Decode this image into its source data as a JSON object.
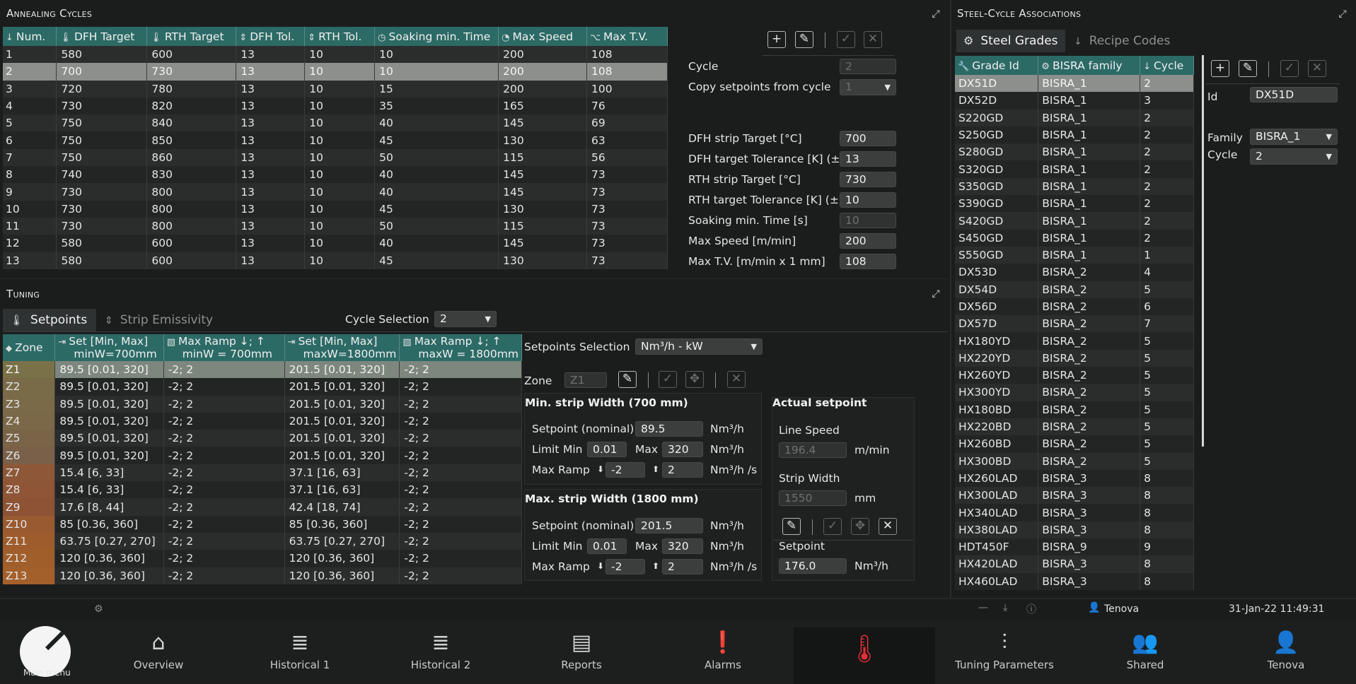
{
  "annealing": {
    "title": "Annealing Cycles",
    "columns": [
      "Num.",
      "DFH Target",
      "RTH Target",
      "DFH Tol.",
      "RTH Tol.",
      "Soaking min. Time",
      "Max Speed",
      "Max T.V."
    ],
    "column_icons": [
      "sort-numeric-icon",
      "thermometer-icon",
      "thermometer-icon",
      "arrows-vertical-icon",
      "arrows-vertical-icon",
      "clock-icon",
      "speedometer-icon",
      "tv-icon"
    ],
    "rows": [
      [
        "1",
        "580",
        "600",
        "13",
        "10",
        "10",
        "200",
        "108"
      ],
      [
        "2",
        "700",
        "730",
        "13",
        "10",
        "10",
        "200",
        "108"
      ],
      [
        "3",
        "720",
        "780",
        "13",
        "10",
        "15",
        "200",
        "100"
      ],
      [
        "4",
        "730",
        "820",
        "13",
        "10",
        "35",
        "165",
        "76"
      ],
      [
        "5",
        "750",
        "840",
        "13",
        "10",
        "40",
        "145",
        "69"
      ],
      [
        "6",
        "750",
        "850",
        "13",
        "10",
        "45",
        "130",
        "63"
      ],
      [
        "7",
        "750",
        "860",
        "13",
        "10",
        "50",
        "115",
        "56"
      ],
      [
        "8",
        "740",
        "830",
        "13",
        "10",
        "40",
        "145",
        "73"
      ],
      [
        "9",
        "730",
        "800",
        "13",
        "10",
        "40",
        "145",
        "73"
      ],
      [
        "10",
        "730",
        "800",
        "13",
        "10",
        "45",
        "130",
        "73"
      ],
      [
        "11",
        "730",
        "800",
        "13",
        "10",
        "50",
        "115",
        "73"
      ],
      [
        "12",
        "580",
        "600",
        "13",
        "10",
        "40",
        "145",
        "73"
      ],
      [
        "13",
        "580",
        "600",
        "13",
        "10",
        "45",
        "130",
        "73"
      ]
    ],
    "selected_row": 1,
    "form": {
      "cycle_label": "Cycle",
      "cycle_value": "2",
      "copy_label": "Copy setpoints from cycle",
      "copy_value": "1",
      "dfh_target_label": "DFH strip Target [°C]",
      "dfh_target_value": "700",
      "dfh_tol_label": "DFH target Tolerance [K] (±)",
      "dfh_tol_value": "13",
      "rth_target_label": "RTH strip Target [°C]",
      "rth_target_value": "730",
      "rth_tol_label": "RTH target Tolerance [K] (±)",
      "rth_tol_value": "10",
      "soak_label": "Soaking min. Time [s]",
      "soak_value": "10",
      "maxspeed_label": "Max Speed [m/min]",
      "maxspeed_value": "200",
      "maxtv_label": "Max T.V. [m/min x 1 mm]",
      "maxtv_value": "108"
    }
  },
  "tuning": {
    "title": "Tuning",
    "tabs": [
      "Setpoints",
      "Strip Emissivity"
    ],
    "cycle_selection_label": "Cycle Selection",
    "cycle_selection_value": "2",
    "columns": [
      "Zone",
      "Set [Min, Max] minW=700mm",
      "Max Ramp ↓; ↑ minW = 700mm",
      "Set [Min, Max] maxW=1800mm",
      "Max Ramp ↓; ↑ maxW = 1800mm"
    ],
    "col_a": [
      "Set [Min, Max]",
      "minW=700mm"
    ],
    "col_b": [
      "Max Ramp ↓; ↑",
      "minW = 700mm"
    ],
    "col_c": [
      "Set [Min, Max]",
      "maxW=1800mm"
    ],
    "col_d": [
      "Max Ramp ↓; ↑",
      "maxW = 1800mm"
    ],
    "rows": [
      [
        "Z1",
        "89.5 [0.01, 320]",
        "-2; 2",
        "201.5 [0.01, 320]",
        "-2; 2"
      ],
      [
        "Z2",
        "89.5 [0.01, 320]",
        "-2; 2",
        "201.5 [0.01, 320]",
        "-2; 2"
      ],
      [
        "Z3",
        "89.5 [0.01, 320]",
        "-2; 2",
        "201.5 [0.01, 320]",
        "-2; 2"
      ],
      [
        "Z4",
        "89.5 [0.01, 320]",
        "-2; 2",
        "201.5 [0.01, 320]",
        "-2; 2"
      ],
      [
        "Z5",
        "89.5 [0.01, 320]",
        "-2; 2",
        "201.5 [0.01, 320]",
        "-2; 2"
      ],
      [
        "Z6",
        "89.5 [0.01, 320]",
        "-2; 2",
        "201.5 [0.01, 320]",
        "-2; 2"
      ],
      [
        "Z7",
        "15.4 [6, 33]",
        "-2; 2",
        "37.1 [16, 63]",
        "-2; 2"
      ],
      [
        "Z8",
        "15.4 [6, 33]",
        "-2; 2",
        "37.1 [16, 63]",
        "-2; 2"
      ],
      [
        "Z9",
        "17.6 [8, 44]",
        "-2; 2",
        "42.4 [18, 74]",
        "-2; 2"
      ],
      [
        "Z10",
        "85 [0.36, 360]",
        "-2; 2",
        "85 [0.36, 360]",
        "-2; 2"
      ],
      [
        "Z11",
        "63.75 [0.27, 270]",
        "-2; 2",
        "63.75 [0.27, 270]",
        "-2; 2"
      ],
      [
        "Z12",
        "120 [0.36, 360]",
        "-2; 2",
        "120 [0.36, 360]",
        "-2; 2"
      ],
      [
        "Z13",
        "120 [0.36, 360]",
        "-2; 2",
        "120 [0.36, 360]",
        "-2; 2"
      ]
    ],
    "zone_colors": [
      "#7a7148",
      "#7a6b48",
      "#7a6a48",
      "#7a6848",
      "#7a6448",
      "#7a6048",
      "#8e5838",
      "#8e5536",
      "#8e5234",
      "#9a5a30",
      "#9e5c2c",
      "#a05e2a",
      "#a4602a"
    ],
    "setpoints_selection_label": "Setpoints Selection",
    "setpoints_selection_value": "Nm³/h - kW",
    "zone_label": "Zone",
    "zone_value": "Z1",
    "min_width": {
      "title": "Min. strip Width (700 mm)",
      "setpoint_label": "Setpoint (nominal)",
      "setpoint_value": "89.5",
      "unit1": "Nm³/h",
      "limit_label": "Limit",
      "min_label": "Min",
      "min_value": "0.01",
      "max_label": "Max",
      "max_value": "320",
      "unit2": "Nm³/h",
      "ramp_label": "Max Ramp",
      "ramp_down": "-2",
      "ramp_up": "2",
      "unit3": "Nm³/h /s"
    },
    "max_width": {
      "title": "Max. strip Width (1800 mm)",
      "setpoint_label": "Setpoint (nominal)",
      "setpoint_value": "201.5",
      "unit1": "Nm³/h",
      "limit_label": "Limit",
      "min_label": "Min",
      "min_value": "0.01",
      "max_label": "Max",
      "max_value": "320",
      "unit2": "Nm³/h",
      "ramp_label": "Max Ramp",
      "ramp_down": "-2",
      "ramp_up": "2",
      "unit3": "Nm³/h /s"
    },
    "actual": {
      "title": "Actual setpoint",
      "line_speed_label": "Line Speed",
      "line_speed_value": "196.4",
      "line_speed_unit": "m/min",
      "strip_width_label": "Strip Width",
      "strip_width_value": "1550",
      "strip_width_unit": "mm",
      "setpoint_label": "Setpoint",
      "setpoint_value": "176.0",
      "setpoint_unit": "Nm³/h"
    }
  },
  "steel": {
    "title": "Steel-Cycle Associations",
    "tabs": [
      "Steel Grades",
      "Recipe Codes"
    ],
    "columns": [
      "Grade Id",
      "BISRA family",
      "Cycle"
    ],
    "rows": [
      [
        "DX51D",
        "BISRA_1",
        "2"
      ],
      [
        "DX52D",
        "BISRA_1",
        "3"
      ],
      [
        "S220GD",
        "BISRA_1",
        "2"
      ],
      [
        "S250GD",
        "BISRA_1",
        "2"
      ],
      [
        "S280GD",
        "BISRA_1",
        "2"
      ],
      [
        "S320GD",
        "BISRA_1",
        "2"
      ],
      [
        "S350GD",
        "BISRA_1",
        "2"
      ],
      [
        "S390GD",
        "BISRA_1",
        "2"
      ],
      [
        "S420GD",
        "BISRA_1",
        "2"
      ],
      [
        "S450GD",
        "BISRA_1",
        "2"
      ],
      [
        "S550GD",
        "BISRA_1",
        "1"
      ],
      [
        "DX53D",
        "BISRA_2",
        "4"
      ],
      [
        "DX54D",
        "BISRA_2",
        "5"
      ],
      [
        "DX56D",
        "BISRA_2",
        "6"
      ],
      [
        "DX57D",
        "BISRA_2",
        "7"
      ],
      [
        "HX180YD",
        "BISRA_2",
        "5"
      ],
      [
        "HX220YD",
        "BISRA_2",
        "5"
      ],
      [
        "HX260YD",
        "BISRA_2",
        "5"
      ],
      [
        "HX300YD",
        "BISRA_2",
        "5"
      ],
      [
        "HX180BD",
        "BISRA_2",
        "5"
      ],
      [
        "HX220BD",
        "BISRA_2",
        "5"
      ],
      [
        "HX260BD",
        "BISRA_2",
        "5"
      ],
      [
        "HX300BD",
        "BISRA_2",
        "5"
      ],
      [
        "HX260LAD",
        "BISRA_3",
        "8"
      ],
      [
        "HX300LAD",
        "BISRA_3",
        "8"
      ],
      [
        "HX340LAD",
        "BISRA_3",
        "8"
      ],
      [
        "HX380LAD",
        "BISRA_3",
        "8"
      ],
      [
        "HDT450F",
        "BISRA_9",
        "9"
      ],
      [
        "HX420LAD",
        "BISRA_3",
        "8"
      ],
      [
        "HX460LAD",
        "BISRA_3",
        "8"
      ]
    ],
    "selected_row": 0,
    "form": {
      "id_label": "Id",
      "id_value": "DX51D",
      "family_label": "Family",
      "family_value": "BISRA_1",
      "cycle_label": "Cycle",
      "cycle_value": "2"
    }
  },
  "statusbar": {
    "user": "Tenova",
    "datetime": "31-Jan-22 11:49:31"
  },
  "nav": {
    "main_menu": "Main menu",
    "items": [
      "Overview",
      "Historical 1",
      "Historical 2",
      "Reports",
      "Alarms",
      "",
      "Tuning Parameters",
      "Shared",
      "Tenova"
    ],
    "icons": [
      "home-icon",
      "database-icon",
      "database-icon",
      "document-icon",
      "alarm-icon",
      "thermometer-icon",
      "sliders-icon",
      "users-icon",
      "user-icon"
    ],
    "active_index": 5,
    "active_color": "#e0303a"
  }
}
